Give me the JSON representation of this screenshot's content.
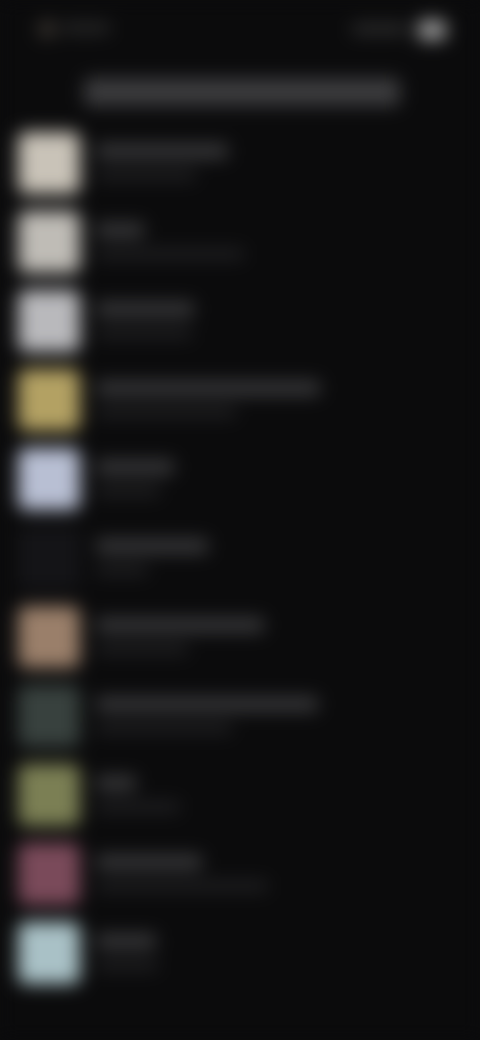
{
  "status_bar": {
    "time": "",
    "icons": [
      "signal-icon",
      "wifi-icon",
      "battery-icon"
    ]
  },
  "header": {
    "title": ""
  },
  "list": {
    "items": [
      {
        "title": "",
        "subtitle": "",
        "thumb_color": "#c9c3b8"
      },
      {
        "title": "",
        "subtitle": "",
        "thumb_color": "#bfbcb6"
      },
      {
        "title": "",
        "subtitle": "",
        "thumb_color": "#b9b9bc"
      },
      {
        "title": "",
        "subtitle": "",
        "thumb_color": "#b3a163"
      },
      {
        "title": "",
        "subtitle": "",
        "thumb_color": "#b8bfd3"
      },
      {
        "title": "",
        "subtitle": "",
        "thumb_color": "#141417"
      },
      {
        "title": "",
        "subtitle": "",
        "thumb_color": "#9a7f6a"
      },
      {
        "title": "",
        "subtitle": "",
        "thumb_color": "#38413e"
      },
      {
        "title": "",
        "subtitle": "",
        "thumb_color": "#7b7f54"
      },
      {
        "title": "",
        "subtitle": "",
        "thumb_color": "#7a4a5a"
      },
      {
        "title": "",
        "subtitle": "",
        "thumb_color": "#a9c1c6"
      }
    ]
  }
}
